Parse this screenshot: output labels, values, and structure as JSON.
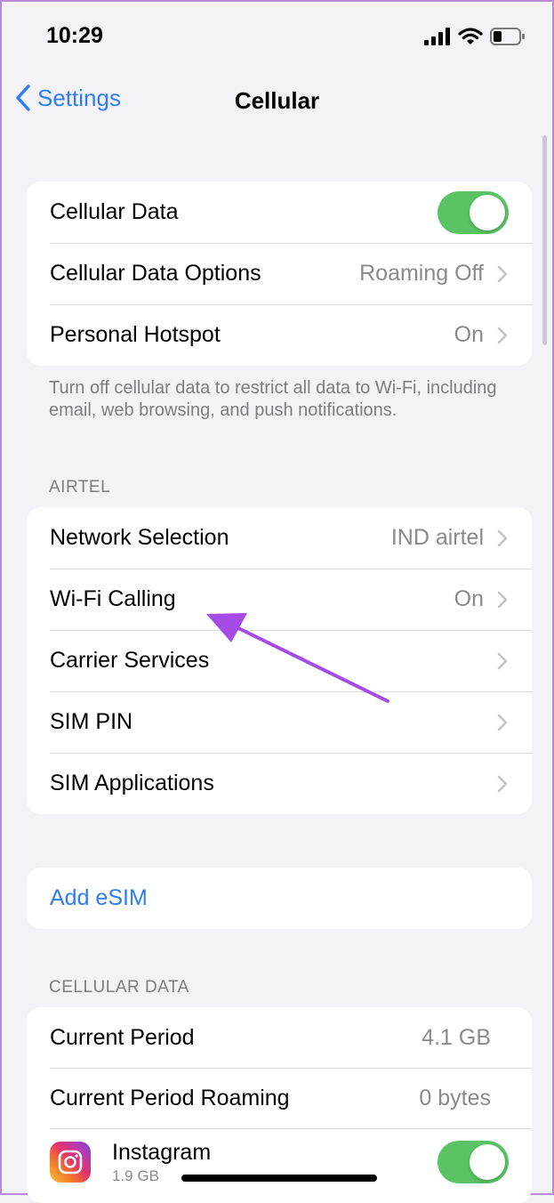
{
  "status": {
    "time": "10:29"
  },
  "nav": {
    "back_label": "Settings",
    "title": "Cellular"
  },
  "group1": {
    "cellular_data": {
      "label": "Cellular Data",
      "on": true
    },
    "data_options": {
      "label": "Cellular Data Options",
      "value": "Roaming Off"
    },
    "hotspot": {
      "label": "Personal Hotspot",
      "value": "On"
    }
  },
  "group1_footer": "Turn off cellular data to restrict all data to Wi-Fi, including email, web browsing, and push notifications.",
  "carrier": {
    "header": "AIRTEL",
    "network_selection": {
      "label": "Network Selection",
      "value": "IND airtel"
    },
    "wifi_calling": {
      "label": "Wi-Fi Calling",
      "value": "On"
    },
    "carrier_services": {
      "label": "Carrier Services"
    },
    "sim_pin": {
      "label": "SIM PIN"
    },
    "sim_apps": {
      "label": "SIM Applications"
    }
  },
  "esim": {
    "label": "Add eSIM"
  },
  "usage": {
    "header": "CELLULAR DATA",
    "current_period": {
      "label": "Current Period",
      "value": "4.1 GB"
    },
    "current_period_roaming": {
      "label": "Current Period Roaming",
      "value": "0 bytes"
    },
    "apps": [
      {
        "name": "Instagram",
        "size": "1.9 GB",
        "on": true,
        "icon": "instagram-icon"
      }
    ]
  },
  "colors": {
    "accent": "#2f7df0",
    "toggle_on": "#5ac465",
    "annotation_arrow": "#a64be8"
  }
}
